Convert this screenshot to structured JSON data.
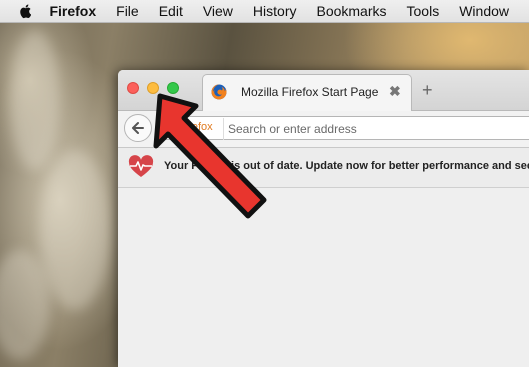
{
  "menubar": {
    "app_name": "Firefox",
    "items": [
      "File",
      "Edit",
      "View",
      "History",
      "Bookmarks",
      "Tools",
      "Window"
    ]
  },
  "tab": {
    "title": "Mozilla Firefox Start Page",
    "close_glyph": "✖",
    "new_tab_glyph": "+"
  },
  "navbar": {
    "identity_label": "Firefox",
    "url_placeholder": "Search or enter address"
  },
  "notification": {
    "text": "Your Firefox is out of date. Update now for better performance and sec"
  },
  "colors": {
    "close": "#fc605b",
    "minimize": "#fdbc40",
    "maximize": "#34c84a",
    "annotation_arrow": "#e8352e"
  },
  "icons": [
    "apple-icon",
    "firefox-favicon-icon",
    "back-arrow-icon",
    "heart-icon"
  ]
}
